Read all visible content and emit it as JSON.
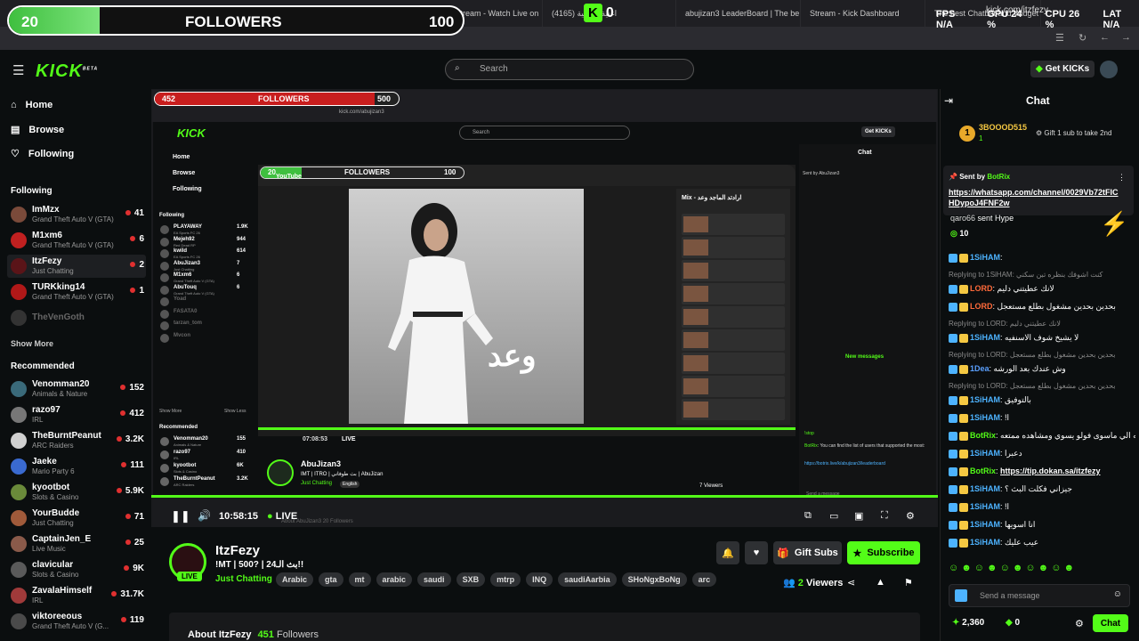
{
  "browser": {
    "tabs": [
      {
        "label": "ItzFezy Stream - Watch Live on"
      },
      {
        "label": "(4165) اغنية خليجية"
      },
      {
        "label": "abujizan3 LeaderBoard | The be"
      },
      {
        "label": "Stream - Kick Dashboard"
      },
      {
        "label": "The best Chatbot and Widget"
      }
    ],
    "url": "kick.com/itzfezy"
  },
  "overlay": {
    "followers_current": "20",
    "followers_label": "FOLLOWERS",
    "followers_goal": "100",
    "followers_progress": 0.2,
    "kick_count": "0",
    "fps_label": "FPS",
    "fps_value": "N/A",
    "gpu_label": "GPU",
    "gpu_value": "24 %",
    "cpu_label": "CPU",
    "cpu_value": "26 %",
    "lat_label": "LAT",
    "lat_value": "N/A"
  },
  "header": {
    "logo": "KICK",
    "logo_sup": "BETA",
    "search_placeholder": "Search",
    "get_kicks": "Get KICKs"
  },
  "sidebar": {
    "nav": [
      {
        "label": "Home",
        "icon": "home-icon"
      },
      {
        "label": "Browse",
        "icon": "browse-icon"
      },
      {
        "label": "Following",
        "icon": "heart-icon"
      }
    ],
    "following_title": "Following",
    "following": [
      {
        "name": "ImMzx",
        "game": "Grand Theft Auto V (GTA)",
        "viewers": "41",
        "color": "#7a4a3a"
      },
      {
        "name": "M1xm6",
        "game": "Grand Theft Auto V (GTA)",
        "viewers": "6",
        "color": "#c02020"
      },
      {
        "name": "ItzFezy",
        "game": "Just Chatting",
        "viewers": "2",
        "color": "#5a1418"
      },
      {
        "name": "TURKking14",
        "game": "Grand Theft Auto V (GTA)",
        "viewers": "1",
        "color": "#b01818"
      },
      {
        "name": "TheVenGoth",
        "game": "",
        "viewers": "",
        "color": "#333"
      }
    ],
    "show_more": "Show More",
    "recommended_title": "Recommended",
    "recommended": [
      {
        "name": "Venomman20",
        "game": "Animals & Nature",
        "viewers": "152",
        "color": "#3a6a7a"
      },
      {
        "name": "razo97",
        "game": "IRL",
        "viewers": "412",
        "color": "#777"
      },
      {
        "name": "TheBurntPeanut",
        "game": "ARC Raiders",
        "viewers": "3.2K",
        "color": "#d0d0d0"
      },
      {
        "name": "Jaeke",
        "game": "Mario Party 6",
        "viewers": "111",
        "color": "#3a6ad0"
      },
      {
        "name": "kyootbot",
        "game": "Slots & Casino",
        "viewers": "5.9K",
        "color": "#6a8a3a"
      },
      {
        "name": "YourBudde",
        "game": "Just Chatting",
        "viewers": "71",
        "color": "#a05a3a"
      },
      {
        "name": "CaptainJen_E",
        "game": "Live Music",
        "viewers": "25",
        "color": "#8a5a4a"
      },
      {
        "name": "clavicular",
        "game": "Slots & Casino",
        "viewers": "9K",
        "color": "#5a5a5a"
      },
      {
        "name": "ZavalaHimself",
        "game": "IRL",
        "viewers": "31.7K",
        "color": "#a03a3a"
      },
      {
        "name": "viktoreeous",
        "game": "Grand Theft Auto V (G...",
        "viewers": "119",
        "color": "#4a4a4a"
      }
    ]
  },
  "inner": {
    "followers_current": "452",
    "followers_label": "FOLLOWERS",
    "followers_goal": "500",
    "followers_progress": 0.9,
    "url": "kick.com/abujizan3",
    "search": "Search",
    "get_kicks": "Get KICKs",
    "nav": [
      "Home",
      "Browse",
      "Following"
    ],
    "following_title": "Following",
    "following": [
      {
        "name": "PLAYAWAY",
        "game": "EA Sports FC 26",
        "viewers": "1.9K"
      },
      {
        "name": "Mejeh92",
        "game": "Red Dead RP",
        "viewers": "944"
      },
      {
        "name": "kwild",
        "game": "EA Sports FC 26",
        "viewers": "614"
      },
      {
        "name": "AbuJizan3",
        "game": "Just Chatting",
        "viewers": "7"
      },
      {
        "name": "M1xm6",
        "game": "Grand Theft Auto V (GTA)",
        "viewers": "6"
      },
      {
        "name": "AbuTouq",
        "game": "Grand Theft Auto V (GTA)",
        "viewers": "6"
      },
      {
        "name": "Yoad",
        "game": "",
        "viewers": ""
      },
      {
        "name": "FASATA0",
        "game": "",
        "viewers": ""
      },
      {
        "name": "tarzan_tom",
        "game": "",
        "viewers": ""
      },
      {
        "name": "Mvcon",
        "game": "",
        "viewers": ""
      }
    ],
    "show_more": "Show More",
    "show_less": "Show Less",
    "recommended_title": "Recommended",
    "recommended": [
      {
        "name": "Venomman20",
        "game": "Animals & Nature",
        "viewers": "155"
      },
      {
        "name": "razo97",
        "game": "IRL",
        "viewers": "410"
      },
      {
        "name": "kyootbot",
        "game": "Slots & Casino",
        "viewers": "6K"
      },
      {
        "name": "TheBurntPeanut",
        "game": "ARC Raiders",
        "viewers": "3.2K"
      }
    ],
    "chat_title": "Chat",
    "sent_by": "Sent by",
    "sent_by_user": "AbuJizan3",
    "new_messages": "New messages",
    "botrix_msg": "You can find the list of users that supported the most:",
    "botrix_link": "https://botrix.live/k/abujizan3/leaderboard",
    "botrix_name": "BotRix",
    "stop": "!stop",
    "streamer": "AbuJizan3",
    "streamer_title": "IMT | ITRO | بث طوفاني | AbuJizan",
    "streamer_cat": "Just Chatting",
    "streamer_tag": "English",
    "viewers": "7 Viewers",
    "about": "About AbuJizan3",
    "about_followers": "20 Followers",
    "time": "07:08:53",
    "live": "LIVE",
    "yt_logo": "YouTube",
    "mix_title": "Mix - ارادتد الماجد وعد",
    "video_text": "وعد",
    "send_message": "Send a message"
  },
  "player": {
    "time": "10:58:15",
    "live": "LIVE"
  },
  "stream": {
    "name": "ItzFezy",
    "title": "!MT | 500? | بث الـ24!!",
    "category": "Just Chatting",
    "tags": [
      "Arabic",
      "gta",
      "mt",
      "arabic",
      "saudi",
      "SXB",
      "mtrp",
      "INQ",
      "saudiAarbia",
      "SHoNgxBoNg",
      "arc"
    ],
    "live": "LIVE",
    "viewers": "2",
    "viewers_label": "Viewers",
    "gift_subs": "Gift Subs",
    "subscribe": "Subscribe",
    "about": "About ItzFezy",
    "followers_count": "451",
    "followers_label": "Followers"
  },
  "chat": {
    "title": "Chat",
    "top_gifter": "3BOOOD515",
    "top_gifter_count": "1",
    "gift_note": "Gift 1 sub to take 2nd",
    "pinned_sent_by": "Sent by",
    "pinned_user": "BotRix",
    "pinned_link": "https://whatsapp.com/channel/0029Vb72tFICHDypoJ4FNF2w",
    "hype_user": "qaro66",
    "hype_text": "sent Hype",
    "hype_count": "10",
    "messages": [
      {
        "type": "msg",
        "user": "1SiHAM",
        "text": "",
        "color": "#4db3ff"
      },
      {
        "type": "reply",
        "text": "Replying to 1SiHAM: كنت اشوفك بنظره تبن سكني"
      },
      {
        "type": "msg",
        "user": "LORD",
        "text": "لانك عطيتني دليم",
        "color": "#ff6a3a"
      },
      {
        "type": "msg",
        "user": "LORD",
        "text": "بحدين بحدين مشغول بطلع مستعجل",
        "color": "#ff6a3a"
      },
      {
        "type": "reply",
        "text": "Replying to LORD: لانك عطيتني دليم"
      },
      {
        "type": "msg",
        "user": "1SiHAM",
        "text": "لا يشيخ شوف الاسنفيه",
        "color": "#4db3ff"
      },
      {
        "type": "reply",
        "text": "Replying to LORD: بحدين بحدين مشغول بطلع مستعجل"
      },
      {
        "type": "msg",
        "user": "1Dea",
        "text": "وش عندك بعد الورشه",
        "color": "#5aa0ff"
      },
      {
        "type": "reply",
        "text": "Replying to LORD: بحدين بحدين مشغول بطلع مستعجل"
      },
      {
        "type": "msg",
        "user": "1SiHAM",
        "text": "بالتوفيق",
        "color": "#4db3ff"
      },
      {
        "type": "msg",
        "user": "1SiHAM",
        "text": "!ا",
        "color": "#4db3ff"
      },
      {
        "type": "msg",
        "user": "BotRix",
        "text": "متورين الجميع حياكم الله الي ماسوى فولو يسوي ومشاهده ممتعه",
        "color": "#53fc18"
      },
      {
        "type": "msg",
        "user": "1SiHAM",
        "text": "دعبرا",
        "color": "#4db3ff"
      },
      {
        "type": "msg",
        "user": "BotRix",
        "text": "https://tip.dokan.sa/itzfezy",
        "color": "#53fc18"
      },
      {
        "type": "msg",
        "user": "1SiHAM",
        "text": "جيزاني فكلت البث ؟",
        "color": "#4db3ff"
      },
      {
        "type": "msg",
        "user": "1SiHAM",
        "text": "!ا",
        "color": "#4db3ff"
      },
      {
        "type": "msg",
        "user": "1SiHAM",
        "text": "انا اسويها",
        "color": "#4db3ff"
      },
      {
        "type": "msg",
        "user": "1SiHAM",
        "text": "عيب عليك",
        "color": "#4db3ff"
      }
    ],
    "send_placeholder": "Send a message",
    "points": "2,360",
    "kicks": "0",
    "chat_button": "Chat"
  }
}
